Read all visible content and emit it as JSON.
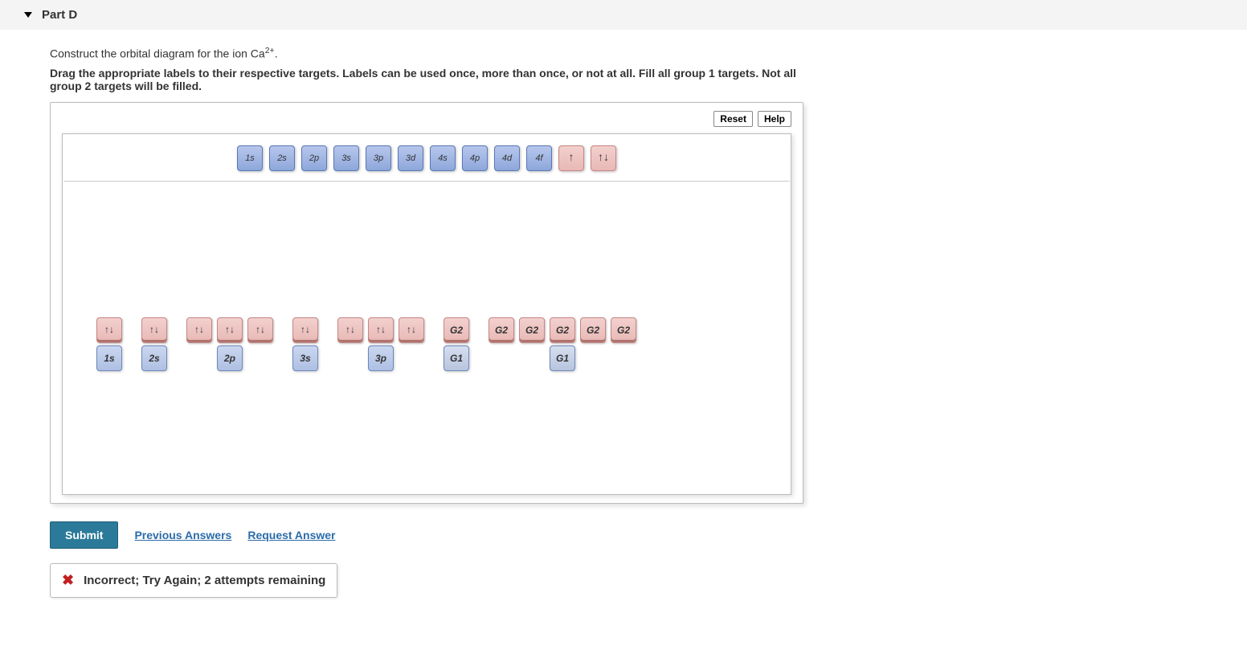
{
  "header": {
    "part_label": "Part D"
  },
  "prompt": {
    "line1_prefix": "Construct the orbital diagram for the ion ",
    "ion_base": "Ca",
    "ion_sup": "2+",
    "line1_suffix": ".",
    "line2": "Drag the appropriate labels to their respective targets. Labels can be used once, more than once, or not at all. Fill all group 1 targets. Not all group 2 targets will be filled."
  },
  "tools": {
    "reset": "Reset",
    "help": "Help"
  },
  "palette": {
    "orbitals": [
      "1s",
      "2s",
      "2p",
      "3s",
      "3p",
      "3d",
      "4s",
      "4p",
      "4d",
      "4f"
    ],
    "arrows_single": "↑",
    "arrows_pair": "↑↓"
  },
  "answer": {
    "clusters": [
      {
        "top": [
          "↑↓"
        ],
        "bottom": "1s"
      },
      {
        "top": [
          "↑↓"
        ],
        "bottom": "2s"
      },
      {
        "top": [
          "↑↓",
          "↑↓",
          "↑↓"
        ],
        "bottom": "2p"
      },
      {
        "top": [
          "↑↓"
        ],
        "bottom": "3s"
      },
      {
        "top": [
          "↑↓",
          "↑↓",
          "↑↓"
        ],
        "bottom": "3p"
      },
      {
        "top": [
          "G2"
        ],
        "bottom": "G1"
      },
      {
        "top": [
          "G2",
          "G2",
          "G2",
          "G2",
          "G2"
        ],
        "bottom": "G1"
      }
    ]
  },
  "actions": {
    "submit": "Submit",
    "previous": "Previous Answers",
    "request": "Request Answer"
  },
  "feedback": {
    "text": "Incorrect; Try Again; 2 attempts remaining"
  }
}
